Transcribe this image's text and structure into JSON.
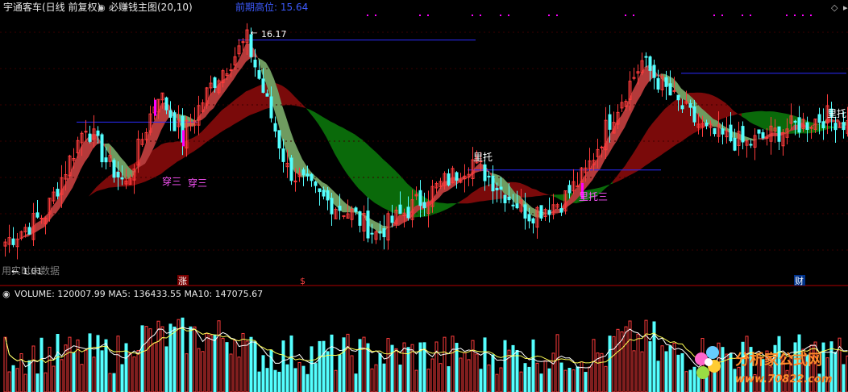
{
  "price_panel": {
    "stock_title": "宇通客车(日线 前复权)",
    "indicator_name": "必赚钱主图(20,10)",
    "recent_high_label": "前期高位: 15.64",
    "peak_label": "16.17",
    "low_label": "1.01",
    "markers": [
      {
        "text": "穿三"
      },
      {
        "text": "穿三"
      },
      {
        "text": "里托"
      },
      {
        "text": "里托三"
      },
      {
        "text": "里托"
      }
    ],
    "bottom_text": "用实时未数据",
    "event_flags": [
      {
        "text": "涨"
      },
      {
        "text": "$"
      },
      {
        "text": "财"
      }
    ]
  },
  "volume_panel": {
    "header": "VOLUME: 120007.99 MA5: 136433.55 MA10: 147075.67"
  },
  "watermark": {
    "brand": "分析家公式网",
    "url": "www.70822.com"
  },
  "colors": {
    "up": "#ff3c3c",
    "down": "#54ffff",
    "ribbon_up": "#b43a3a",
    "ribbon_down": "#6f9b60",
    "band_red": "#7a0a0a",
    "band_green": "#0a6a0a",
    "magenta": "#ff00ff",
    "blue_line": "#2b2bff",
    "ma5": "#ffffff",
    "ma10": "#ffff55"
  },
  "chart_data": {
    "type": "candlestick",
    "title": "宇通客车(日线 前复权)",
    "series": [
      {
        "name": "必赚钱主图(20,10)"
      },
      {
        "name": "VOLUME",
        "last": 120007.99
      },
      {
        "name": "MA5",
        "last": 136433.55
      },
      {
        "name": "MA10",
        "last": 147075.67
      }
    ],
    "annotations": [
      "前期高位: 15.64",
      "16.17",
      "1.01",
      "穿三",
      "里托",
      "里托三"
    ],
    "price_anchors": [
      [
        0,
        11.2
      ],
      [
        10,
        11.9
      ],
      [
        20,
        14.1
      ],
      [
        25,
        13.2
      ],
      [
        30,
        12.6
      ],
      [
        38,
        14.9
      ],
      [
        44,
        13.8
      ],
      [
        52,
        15.2
      ],
      [
        60,
        16.17
      ],
      [
        65,
        14.6
      ],
      [
        70,
        13.0
      ],
      [
        78,
        12.3
      ],
      [
        86,
        11.9
      ],
      [
        92,
        11.4
      ],
      [
        100,
        12.0
      ],
      [
        108,
        12.6
      ],
      [
        116,
        13.2
      ],
      [
        124,
        12.4
      ],
      [
        130,
        11.9
      ],
      [
        138,
        12.2
      ],
      [
        144,
        12.9
      ],
      [
        150,
        14.2
      ],
      [
        158,
        15.64
      ],
      [
        166,
        14.7
      ],
      [
        174,
        13.9
      ],
      [
        184,
        13.6
      ],
      [
        194,
        14.0
      ],
      [
        204,
        14.3
      ],
      [
        209,
        14.1
      ]
    ],
    "ylim": [
      10.6,
      16.6
    ]
  }
}
